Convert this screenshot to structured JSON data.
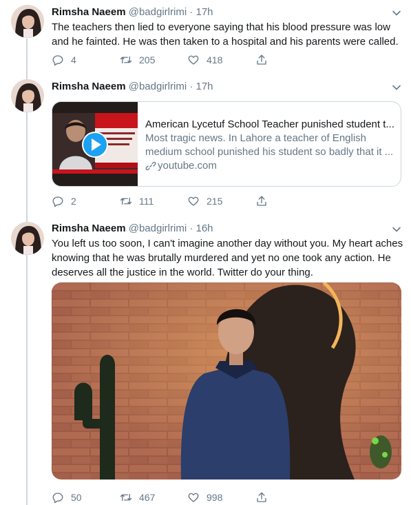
{
  "tweets": [
    {
      "author": "Rimsha Naeem",
      "handle": "@badgirlrimi",
      "dot": "·",
      "time": "17h",
      "text": "The teachers then lied to everyone saying that his blood pressure was low and he fainted. He was then taken to a hospital and his parents were called.",
      "replies": "4",
      "retweets": "205",
      "likes": "418"
    },
    {
      "author": "Rimsha Naeem",
      "handle": "@badgirlrimi",
      "dot": "·",
      "time": "17h",
      "card": {
        "title": "American Lycetuf School Teacher punished student t...",
        "description": "Most tragic news. In Lahore a teacher of English medium school punished his student so badly that it ...",
        "domain": "youtube.com"
      },
      "replies": "2",
      "retweets": "111",
      "likes": "215"
    },
    {
      "author": "Rimsha Naeem",
      "handle": "@badgirlrimi",
      "dot": "·",
      "time": "16h",
      "text": "You left us too soon, I can't imagine another day without you. My heart aches knowing that he was brutally murdered and yet no one took any action. He deserves all the justice in the world. Twitter do your thing.",
      "replies": "50",
      "retweets": "467",
      "likes": "998"
    }
  ],
  "colors": {
    "text": "#14171a",
    "secondary": "#657786",
    "border": "#ccd6dd",
    "play_button": "#1da1f2"
  },
  "icons": [
    "reply-icon",
    "retweet-icon",
    "like-icon",
    "share-icon",
    "chevron-down-icon",
    "link-icon",
    "play-icon"
  ]
}
